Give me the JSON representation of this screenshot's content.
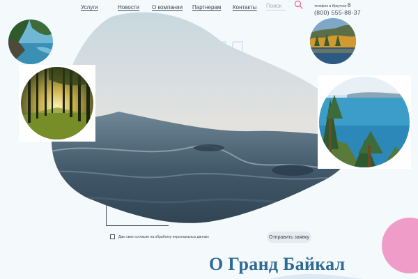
{
  "nav": {
    "items": [
      {
        "label": "Услуги"
      },
      {
        "label": "Новости"
      },
      {
        "label": "О компании"
      },
      {
        "label": "Партнерам"
      },
      {
        "label": "Контакты"
      }
    ]
  },
  "search": {
    "placeholder": "Поиск",
    "icon": "search-icon"
  },
  "contact": {
    "label_prefix": "телефон в Иркутске",
    "label_suffix": "8",
    "phone": "(800) 555-88-37"
  },
  "form": {
    "consent_text": "Даю свое согласие на обработку персональных данных",
    "consent_checked": false,
    "submit_label": "Отправить заявку"
  },
  "about": {
    "title": "О Гранд Байкал"
  },
  "colors": {
    "accent_pink": "#ef9cc8",
    "title_blue": "#2f6a93",
    "search_icon": "#e0667d"
  },
  "photos": [
    {
      "name": "photo-lake-shore"
    },
    {
      "name": "photo-forest-sunset"
    },
    {
      "name": "photo-autumn-lake"
    },
    {
      "name": "photo-pine-lake"
    }
  ]
}
